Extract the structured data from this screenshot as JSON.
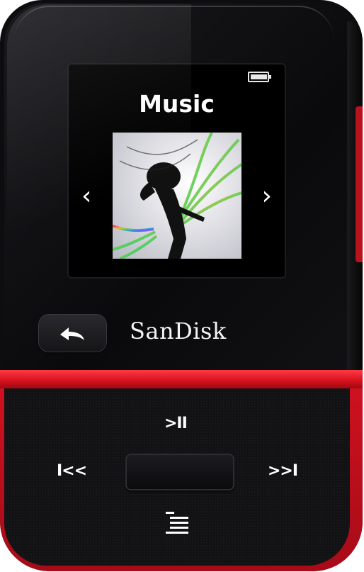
{
  "device": {
    "brand": "SanDisk",
    "accent_color": "#d4101c",
    "body_color": "#0d0d0f"
  },
  "screen": {
    "title": "Music",
    "battery_level": 0.9,
    "prev_arrow": "‹",
    "next_arrow": "›",
    "album_art": "album-art-guitarist"
  },
  "controls": {
    "play_pause": ">II",
    "previous": "I<<",
    "next": ">>I",
    "back_icon": "back-arrow-icon",
    "menu_icon": "menu-lines-icon"
  }
}
